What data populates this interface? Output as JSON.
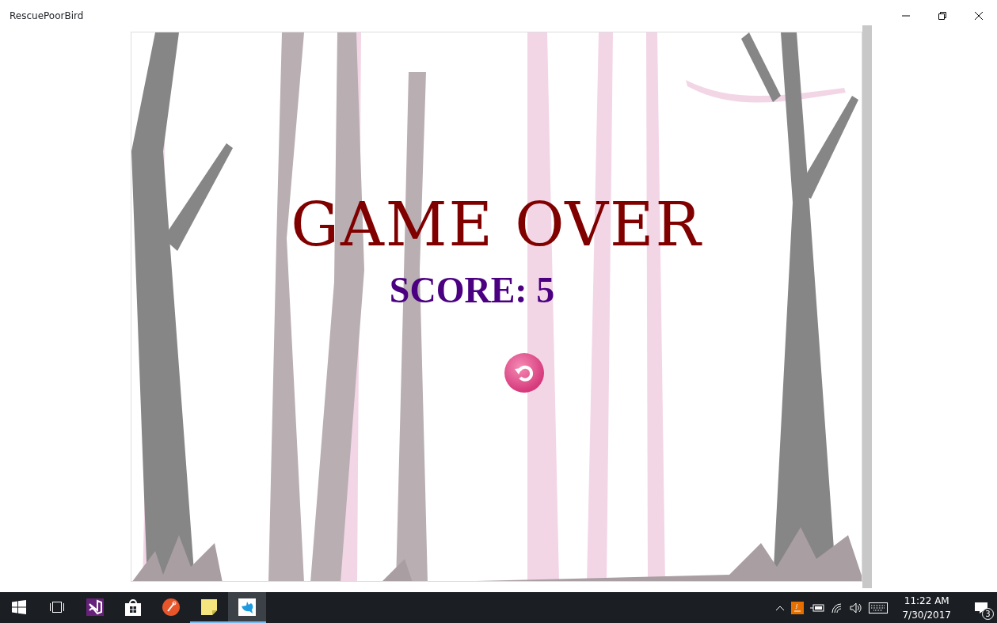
{
  "window": {
    "title": "RescuePoorBird"
  },
  "game": {
    "title": "GAME OVER",
    "score": "SCORE: 5"
  },
  "taskbar": {
    "apps": [
      {
        "kind": "start",
        "running": false,
        "selected": false
      },
      {
        "kind": "taskview",
        "running": false,
        "selected": false
      },
      {
        "kind": "studio",
        "running": false,
        "selected": false
      },
      {
        "kind": "store",
        "running": false,
        "selected": false
      },
      {
        "kind": "paint",
        "running": false,
        "selected": false
      },
      {
        "kind": "notes",
        "running": true,
        "selected": false
      },
      {
        "kind": "bird",
        "running": true,
        "selected": true
      }
    ],
    "time": "11:22 AM",
    "date": "7/30/2017",
    "notifications": "3"
  }
}
